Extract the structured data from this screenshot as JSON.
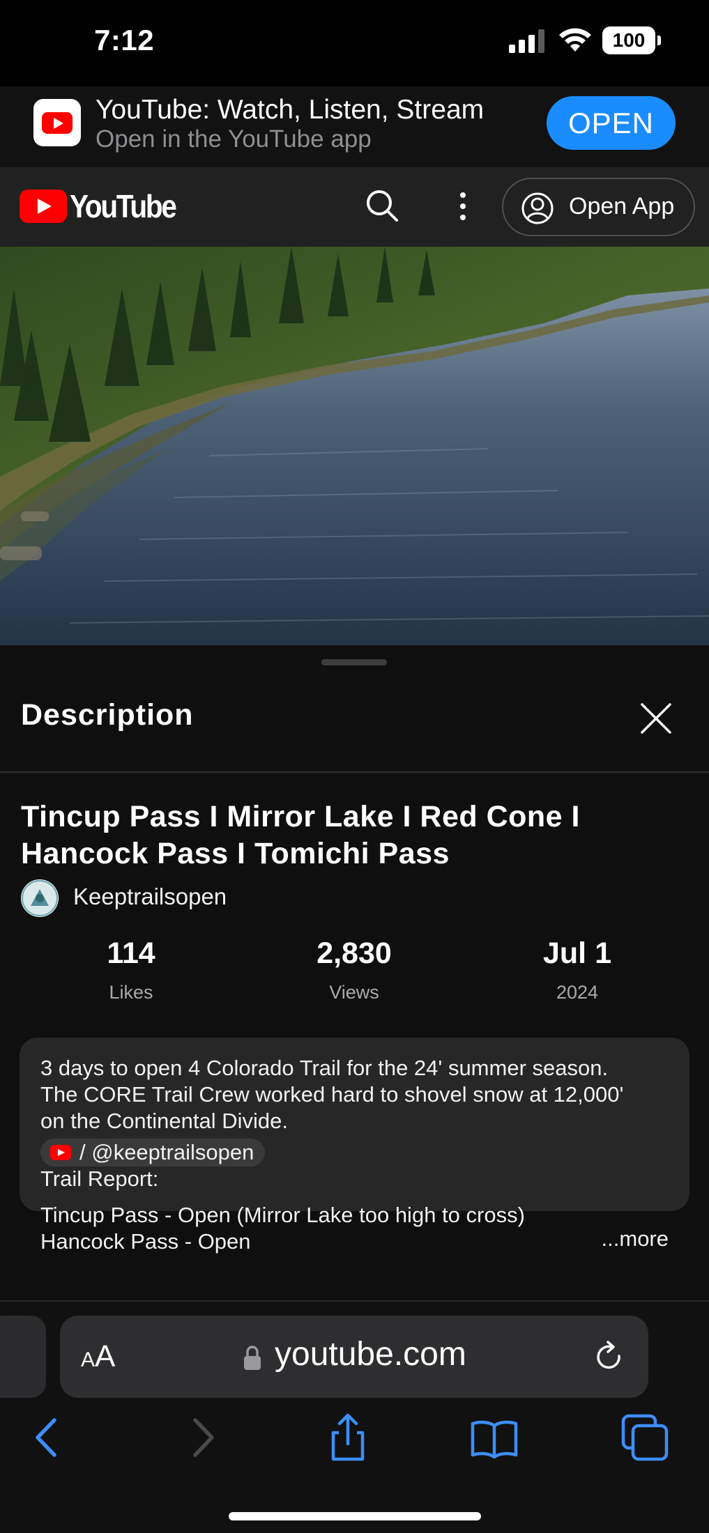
{
  "status_bar": {
    "time": "7:12",
    "battery": "100"
  },
  "app_banner": {
    "title": "YouTube: Watch, Listen, Stream",
    "subtitle": "Open in the YouTube app",
    "open_label": "OPEN"
  },
  "header": {
    "logo_text": "YouTube",
    "open_app_label": "Open App"
  },
  "description_sheet": {
    "title": "Description",
    "video_title": "Tincup Pass I Mirror Lake I Red Cone I Hancock Pass I Tomichi Pass",
    "channel": "Keeptrailsopen",
    "stats": {
      "likes_value": "114",
      "likes_label": "Likes",
      "views_value": "2,830",
      "views_label": "Views",
      "date_value": "Jul 1",
      "date_label": "2024"
    },
    "description": {
      "line1": "3 days to open 4 Colorado Trail for the 24' summer season.",
      "line2": "The CORE Trail Crew worked hard to shovel snow at 12,000'",
      "line3": "on the Continental Divide.",
      "handle": "/ @keeptrailsopen",
      "line4": "Trail Report:",
      "line5": "Tincup Pass - Open (Mirror Lake too high to cross)",
      "line6": "Hancock Pass - Open",
      "more": "...more"
    }
  },
  "safari": {
    "aa_small": "A",
    "aa_big": "A",
    "url": "youtube.com"
  },
  "colors": {
    "youtube_red": "#ff0000",
    "open_button_blue": "#1a8cff",
    "safari_accent": "#3d8ef7"
  }
}
